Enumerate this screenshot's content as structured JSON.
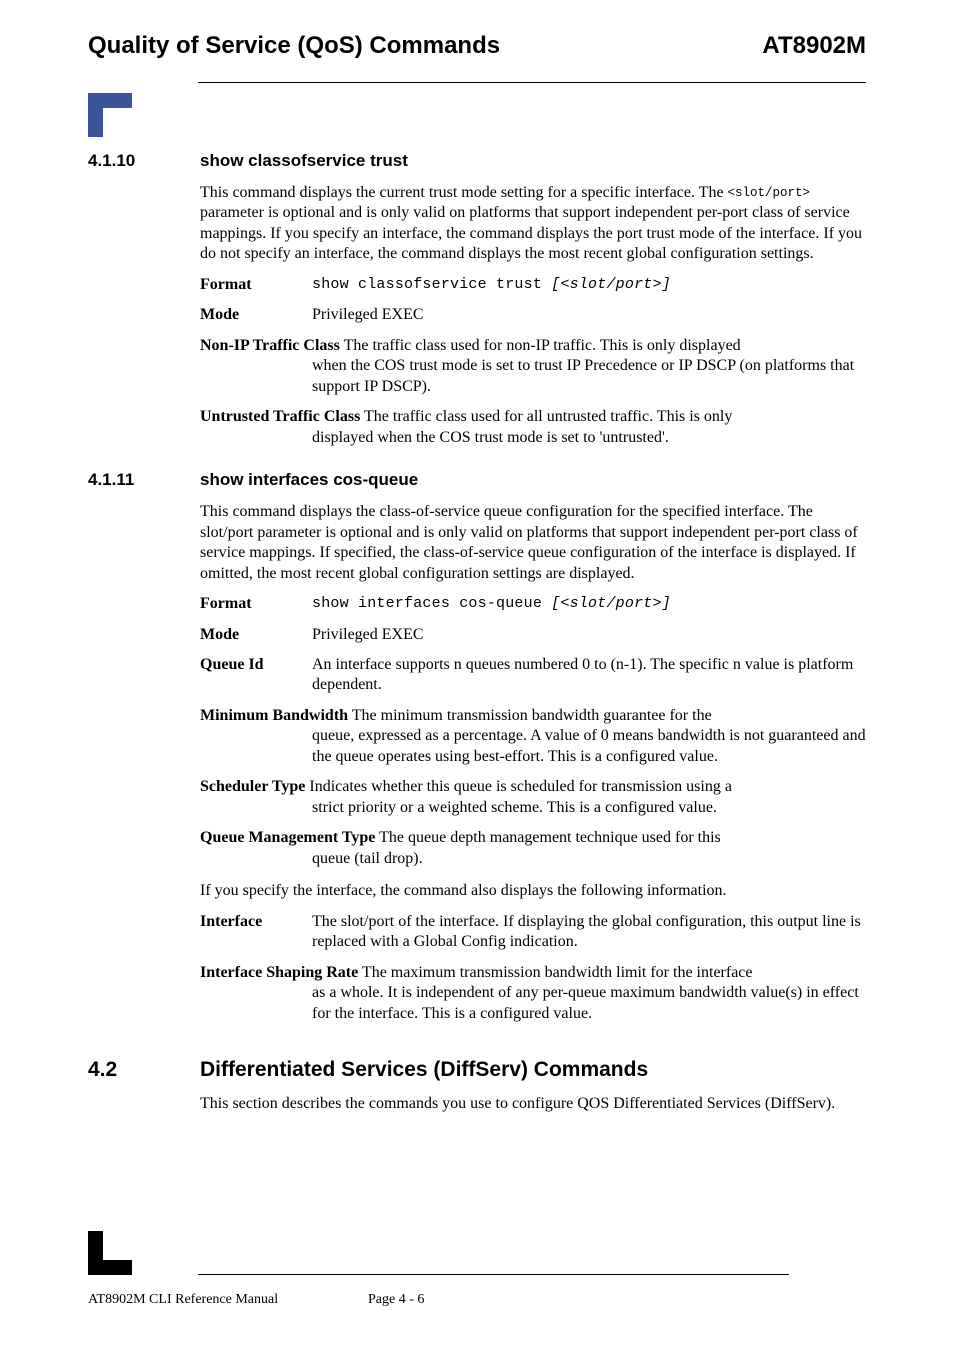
{
  "header": {
    "left": "Quality of Service (QoS) Commands",
    "right": "AT8902M"
  },
  "s1": {
    "num": "4.1.10",
    "title": "show classofservice trust",
    "desc_a": "This command displays the current trust mode setting for a specific interface. The ",
    "desc_b": " parameter is optional and is only valid on platforms that support independent per-port class of service mappings. If you specify an interface, the command displays the port trust mode of the interface. If you do not specify an interface, the command displays the most recent global configuration settings.",
    "slotport": "<slot/port>",
    "format_k": "Format",
    "format_a": "show classofservice trust ",
    "format_b": "[<slot/port>]",
    "mode_k": "Mode",
    "mode_v": "Privileged EXEC",
    "nonip_k": "Non-IP Traffic Class",
    "nonip_a": "  The traffic class used for non-IP traffic. This is only displayed ",
    "nonip_b": "when the COS trust mode is set to trust IP Precedence or IP DSCP (on platforms that support IP DSCP).",
    "untr_k": "Untrusted Traffic Class",
    "untr_a": "  The traffic class used for all untrusted traffic. This is only ",
    "untr_b": "displayed when the COS trust mode is set to 'untrusted'."
  },
  "s2": {
    "num": "4.1.11",
    "title": "show interfaces cos-queue",
    "desc": "This command displays the class-of-service queue configuration for the specified interface. The slot/port parameter is optional and is only valid on platforms that support independent per-port class of service mappings. If specified, the class-of-service queue configuration of the interface is displayed. If omitted, the most recent global configuration settings are displayed.",
    "format_k": "Format",
    "format_a": "show interfaces cos-queue ",
    "format_b": "[<slot/port>]",
    "mode_k": "Mode",
    "mode_v": "Privileged EXEC",
    "qid_k": "Queue Id",
    "qid_v": "An interface supports n queues numbered 0 to (n-1). The specific n value is platform dependent.",
    "mbw_k": "Minimum Bandwidth",
    "mbw_a": "  The minimum transmission bandwidth guarantee for the ",
    "mbw_b": "queue, expressed as a percentage. A value of 0 means bandwidth is not guaranteed and the queue operates using best-effort. This is a configured value.",
    "sch_k": "Scheduler Type",
    "sch_a": "  Indicates whether this queue is scheduled for transmission using a ",
    "sch_b": "strict priority or a weighted scheme. This is a configured value.",
    "qmt_k": "Queue Management Type",
    "qmt_a": "  The queue depth management technique used for this ",
    "qmt_b": "queue (tail drop).",
    "ifnote": "If you specify the interface, the command also displays the following information.",
    "intf_k": "Interface",
    "intf_v": "The slot/port of the interface. If displaying the global configuration, this output line is replaced with a Global Config indication.",
    "isr_k": "Interface Shaping Rate",
    "isr_a": "  The maximum transmission bandwidth limit for the interface ",
    "isr_b": "as a whole. It is independent of any per-queue maximum bandwidth value(s) in effect for the interface. This is a configured value."
  },
  "s3": {
    "num": "4.2",
    "title": "Differentiated Services (DiffServ) Commands",
    "desc": "This section describes the commands you use to configure QOS Differentiated Services (DiffServ)."
  },
  "footer": {
    "manual": "AT8902M CLI Reference Manual",
    "page": "Page 4 - 6"
  }
}
